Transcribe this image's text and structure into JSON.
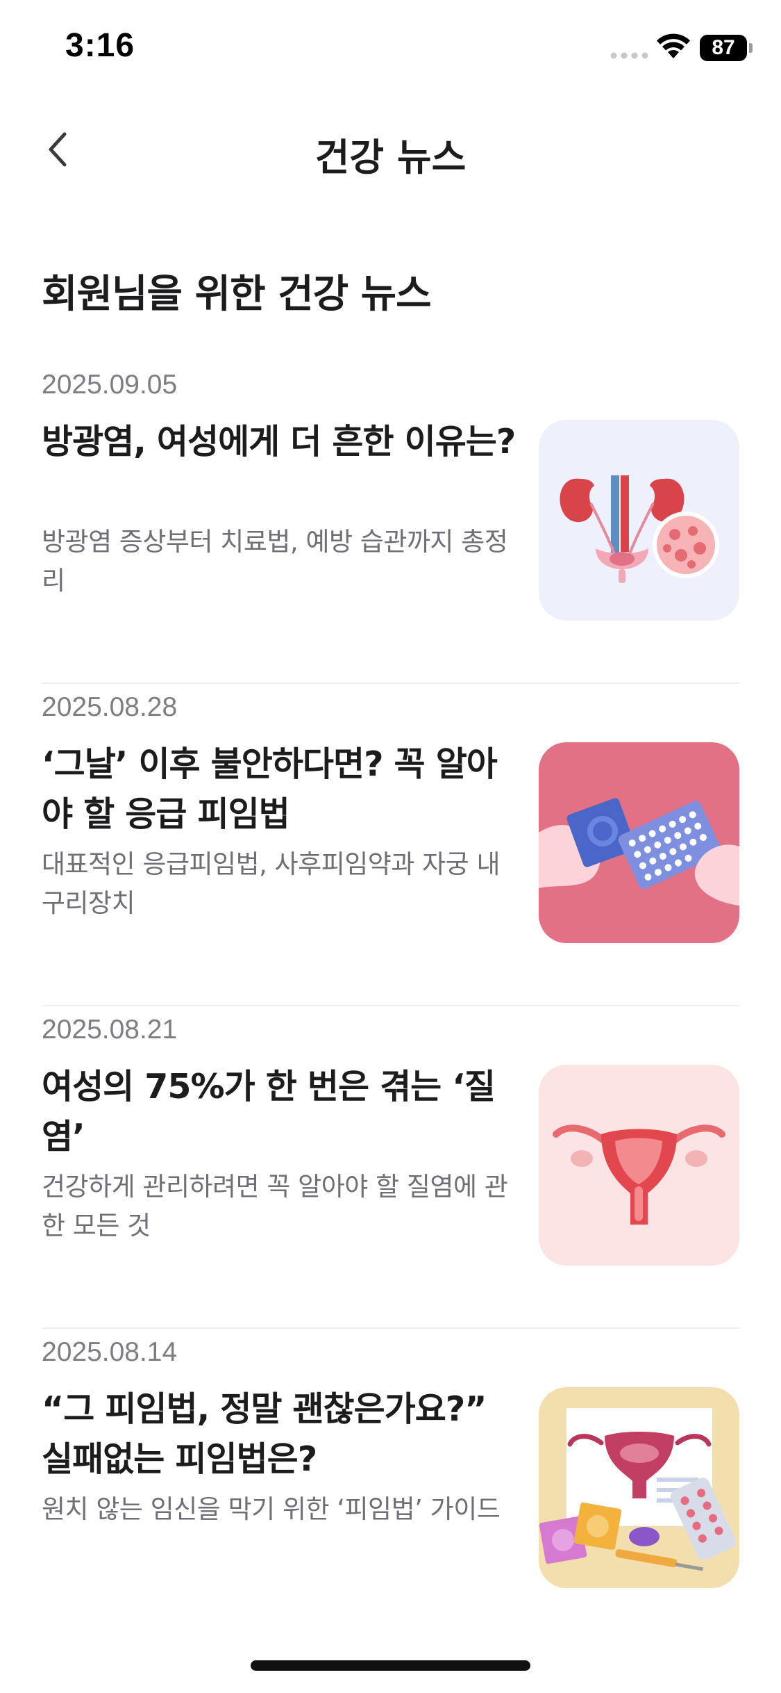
{
  "status_bar": {
    "time": "3:16",
    "battery": "87"
  },
  "nav": {
    "title": "건강 뉴스"
  },
  "section": {
    "title": "회원님을 위한 건강 뉴스"
  },
  "articles": [
    {
      "date": "2025.09.05",
      "title": "방광염, 여성에게 더 흔한 이유는?",
      "description": "방광염 증상부터 치료법, 예방 습관까지 총정리",
      "thumbnail_icon": "kidney-bladder-illustration",
      "thumbnail_bg": "#eef1fb"
    },
    {
      "date": "2025.08.28",
      "title": "‘그날’ 이후 불안하다면? 꼭 알아야 할 응급 피임법",
      "description": "대표적인 응급피임법, 사후피임약과 자궁 내 구리장치",
      "thumbnail_icon": "condom-pill-pack-illustration",
      "thumbnail_bg": "#e37185"
    },
    {
      "date": "2025.08.21",
      "title": "여성의 75%가 한 번은 겪는 ‘질염’",
      "description": "건강하게 관리하려면 꼭 알아야 할 질염에 관한 모든 것",
      "thumbnail_icon": "uterus-illustration",
      "thumbnail_bg": "#fde4e4"
    },
    {
      "date": "2025.08.14",
      "title": "“그 피임법, 정말 괜찮은가요?” 실패없는 피임법은?",
      "description": "원치 않는 임신을 막기 위한 ‘피임법’ 가이드",
      "thumbnail_icon": "contraception-methods-illustration",
      "thumbnail_bg": "#f3dfae"
    }
  ]
}
